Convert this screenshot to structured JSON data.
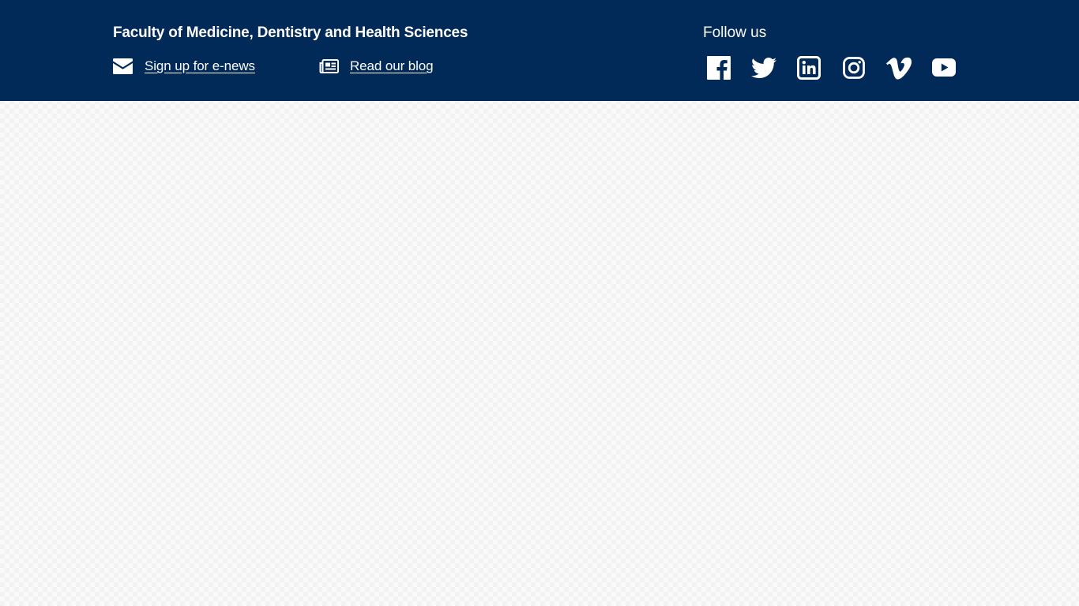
{
  "footer": {
    "faculty_name": "Faculty of Medicine, Dentistry and Health Sciences",
    "links": {
      "enews": {
        "label": "Sign up for e-news",
        "icon": "envelope-icon"
      },
      "blog": {
        "label": "Read our blog",
        "icon": "newspaper-icon"
      }
    },
    "follow_label": "Follow us",
    "social": [
      {
        "name": "Facebook",
        "icon": "facebook-icon"
      },
      {
        "name": "Twitter",
        "icon": "twitter-icon"
      },
      {
        "name": "LinkedIn",
        "icon": "linkedin-icon"
      },
      {
        "name": "Instagram",
        "icon": "instagram-icon"
      },
      {
        "name": "Vimeo",
        "icon": "vimeo-icon"
      },
      {
        "name": "YouTube",
        "icon": "youtube-icon"
      }
    ]
  },
  "colors": {
    "footer_background": "#012a58",
    "footer_text": "#ffffff",
    "page_background": "#fafafa"
  }
}
